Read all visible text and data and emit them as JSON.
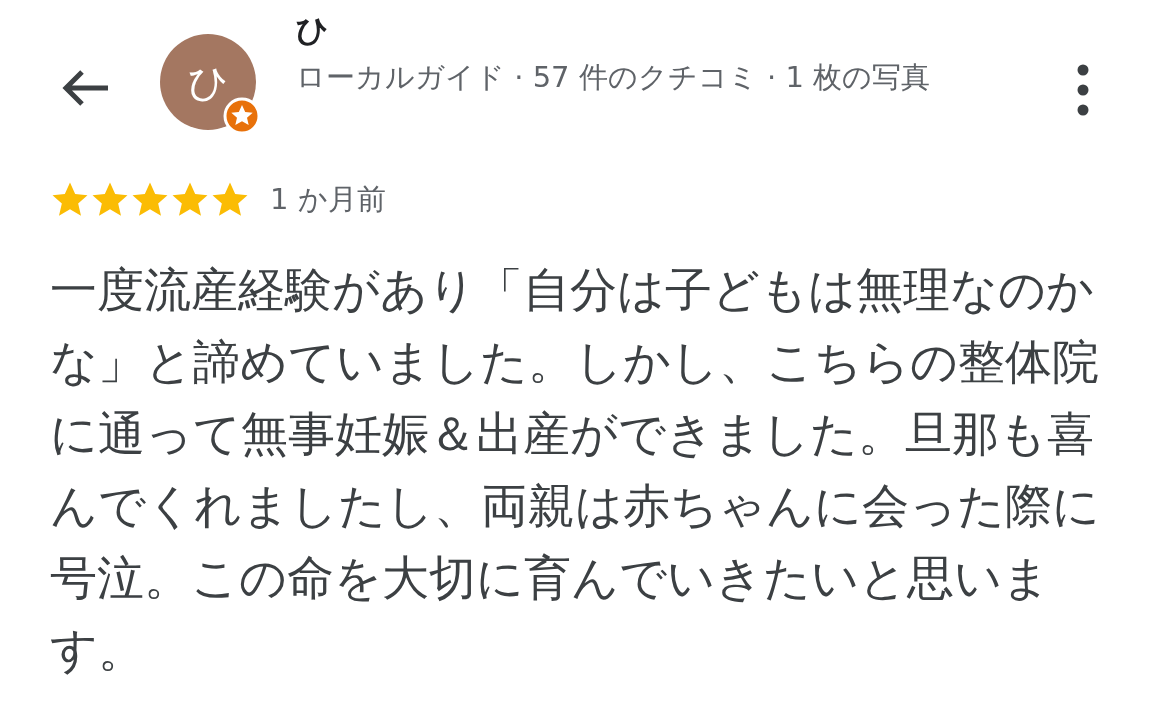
{
  "reviewer": {
    "name": "ひ",
    "avatar_letter": "ひ",
    "subtitle": "ローカルガイド · 57 件のクチコミ · 1 枚の写真"
  },
  "review": {
    "stars": 5,
    "time": "1 か月前",
    "text": "一度流産経験があり「自分は子どもは無理なのかな」と諦めていました。しかし、こちらの整体院に通って無事妊娠＆出産ができました。旦那も喜んでくれましたし、両親は赤ちゃんに会った際に号泣。この命を大切に育んでいきたいと思います。"
  }
}
